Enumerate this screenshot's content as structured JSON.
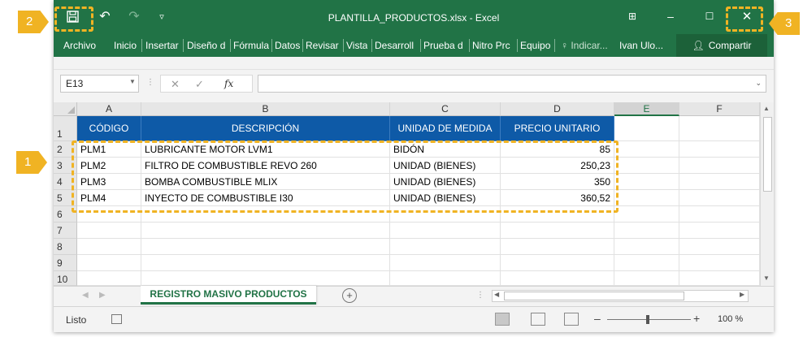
{
  "window": {
    "filename_title": "PLANTILLA_PRODUCTOS.xlsx - Excel",
    "icons": [
      "save-icon",
      "undo-icon",
      "redo-icon",
      "customize-qat-icon",
      "ribbon-display-icon",
      "minimize-icon",
      "restore-icon",
      "close-icon"
    ]
  },
  "ribbon": {
    "tabs": [
      "Archivo",
      "Inicio",
      "Insertar",
      "Diseño d",
      "Fórmula",
      "Datos",
      "Revisar",
      "Vista",
      "Desarroll",
      "Prueba d",
      "Nitro Prc",
      "Equipo"
    ],
    "tell_me": "Indicar...",
    "user": "Ivan Ulo...",
    "share_label": "Compartir"
  },
  "formula_bar": {
    "name_box": "E13",
    "fx_label": "fx",
    "formula": ""
  },
  "sheet": {
    "columns": [
      "A",
      "B",
      "C",
      "D",
      "E",
      "F"
    ],
    "active_column": "E",
    "row_numbers": [
      "1",
      "2",
      "3",
      "4",
      "5",
      "6",
      "7",
      "8",
      "9",
      "10"
    ],
    "header_row": [
      "CÓDIGO",
      "DESCRIPCIÓN",
      "UNIDAD DE MEDIDA",
      "PRECIO UNITARIO"
    ],
    "rows": [
      [
        "PLM1",
        "LUBRICANTE MOTOR LVM1",
        "BIDÓN",
        "85"
      ],
      [
        "PLM2",
        "FILTRO DE COMBUSTIBLE REVO 260",
        "UNIDAD (BIENES)",
        "250,23"
      ],
      [
        "PLM3",
        "BOMBA COMBUSTIBLE MLIX",
        "UNIDAD (BIENES)",
        "350"
      ],
      [
        "PLM4",
        "INYECTO DE COMBUSTIBLE I30",
        "UNIDAD (BIENES)",
        "360,52"
      ]
    ],
    "header_color": "#0e5aa7"
  },
  "sheet_tabs": {
    "active": "REGISTRO MASIVO PRODUCTOS"
  },
  "status_bar": {
    "status": "Listo",
    "zoom": "100 %"
  },
  "annotations": {
    "callouts": [
      "1",
      "2",
      "3"
    ],
    "color": "#f0b323"
  },
  "theme": {
    "excel_green": "#217346"
  }
}
